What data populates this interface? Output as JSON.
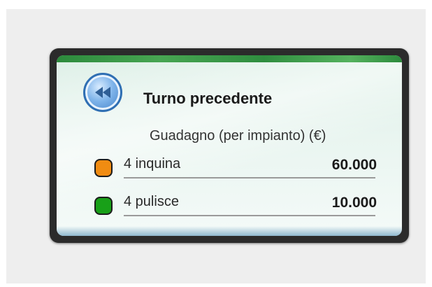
{
  "panel": {
    "title": "Turno precedente",
    "subtitle": "Guadagno (per impianto) (€)",
    "back_icon": "rewind-icon"
  },
  "rows": [
    {
      "label": "4 inquina",
      "value": "60.000",
      "color": "#f08c12"
    },
    {
      "label": "4 pulisce",
      "value": "10.000",
      "color": "#18a018"
    }
  ]
}
